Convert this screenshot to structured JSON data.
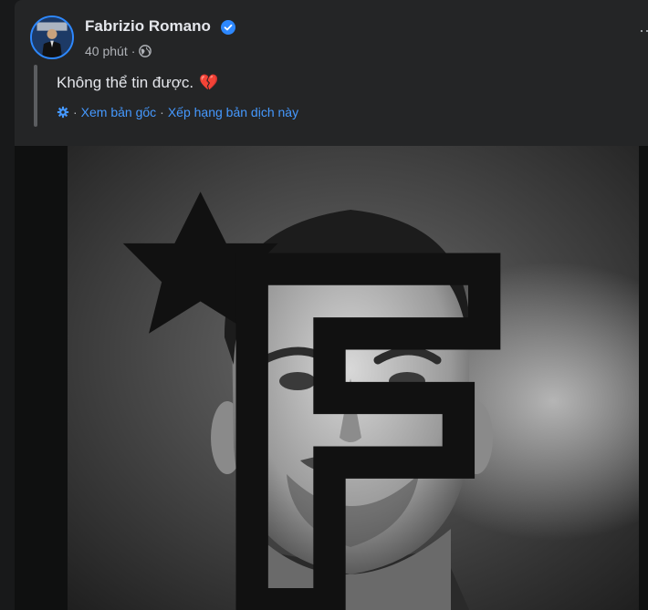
{
  "post": {
    "author": {
      "name": "Fabrizio Romano",
      "verified": true,
      "avatar_icon": "avatar-photo"
    },
    "timestamp": "40 phút",
    "meta_separator": "·",
    "audience_icon": "globe-icon",
    "text": "Không thể tin được.",
    "emoji": "💔",
    "translation": {
      "icon": "gear-icon",
      "sep1": "·",
      "see_original": "Xem bản gốc",
      "sep2": "·",
      "rate_translation": "Xếp hạng bản dịch này"
    },
    "more_options_icon": "more-icon",
    "photo": {
      "description_icon": "brand-logo-icon",
      "style": "black-and-white portrait"
    }
  },
  "colors": {
    "background": "#18191a",
    "card": "#242526",
    "text_primary": "#e4e6eb",
    "text_secondary": "#b0b3b8",
    "link": "#4599ff",
    "verified": "#2d88ff"
  }
}
